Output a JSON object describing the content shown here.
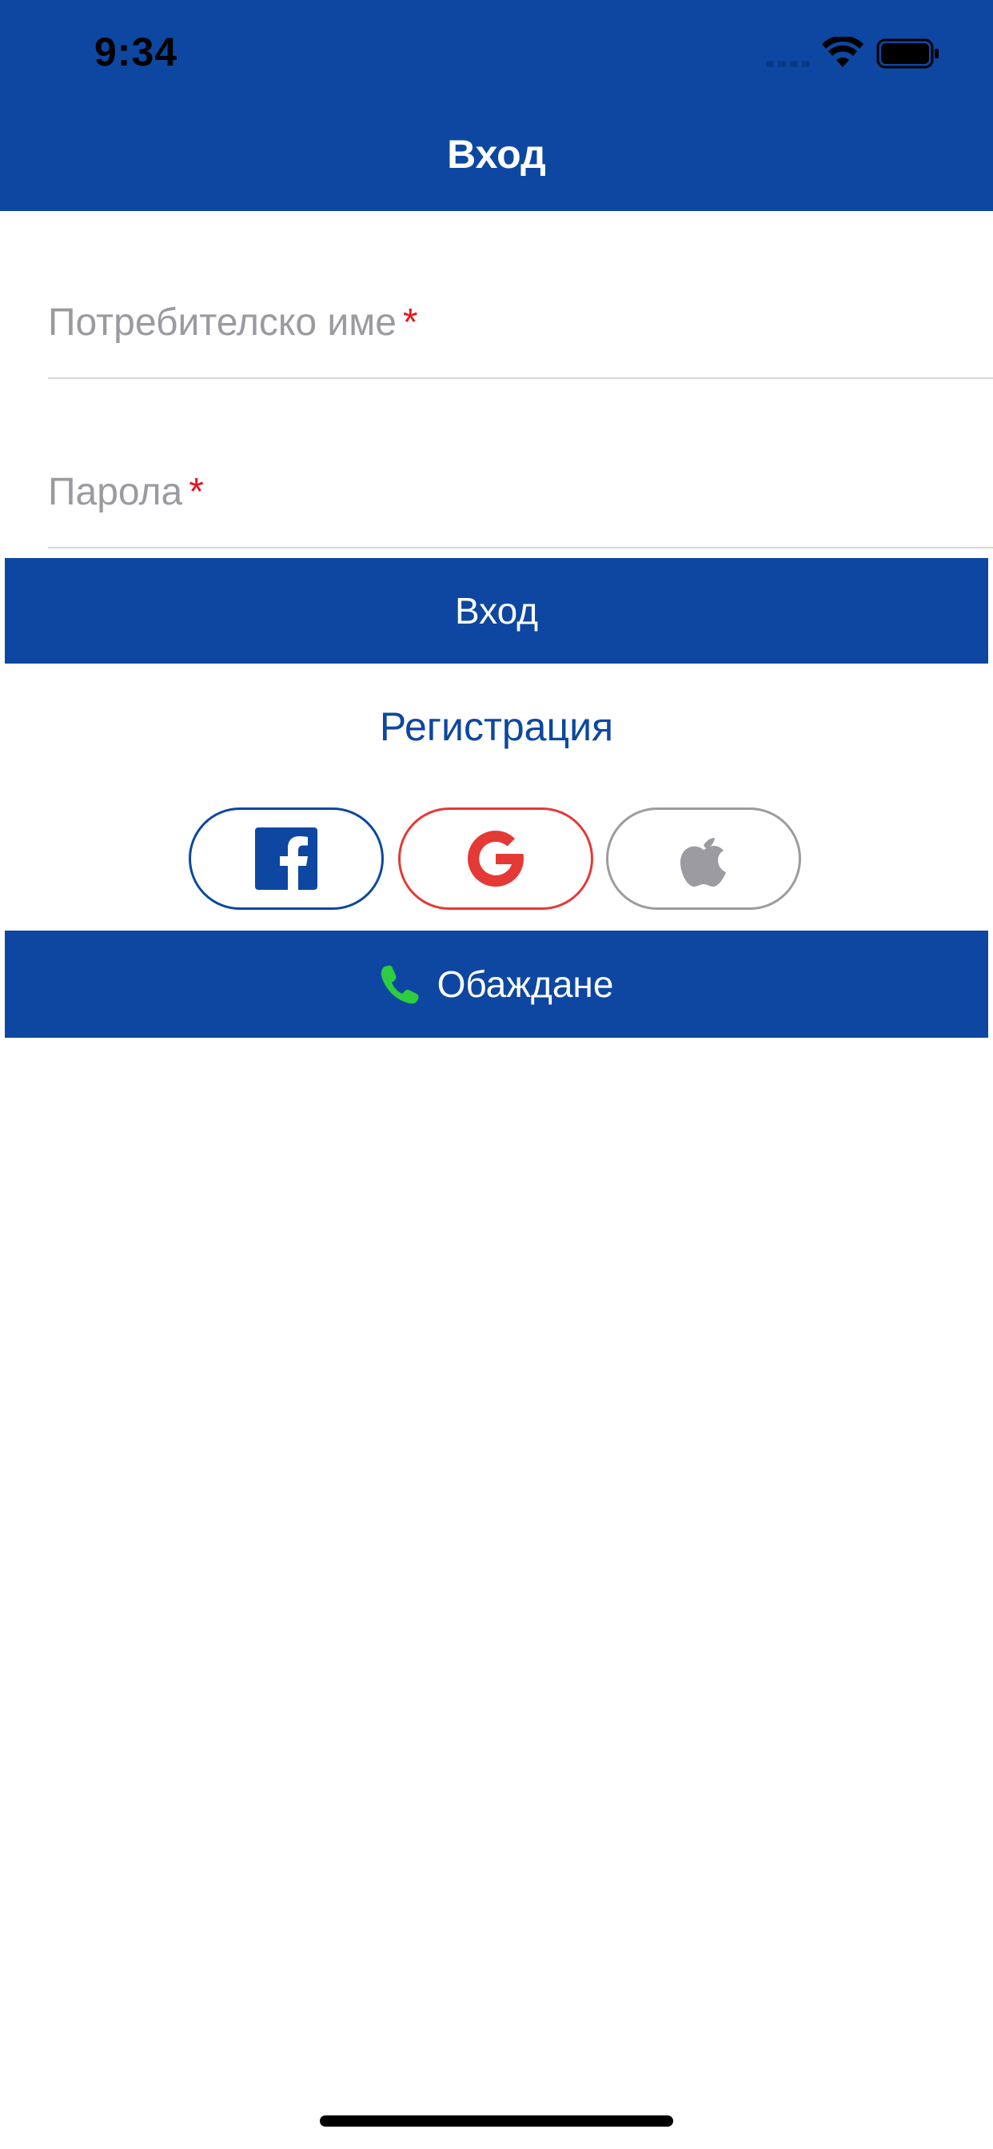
{
  "status_bar": {
    "time": "9:34"
  },
  "header": {
    "title": "Вход"
  },
  "form": {
    "username_label": "Потребителско име",
    "password_label": "Парола",
    "required_marker": "*",
    "login_label": "Вход",
    "register_label": "Регистрация"
  },
  "social": {
    "icons": [
      "facebook-icon",
      "google-icon",
      "apple-icon"
    ]
  },
  "call": {
    "label": "Обаждане",
    "icon": "phone-icon"
  },
  "colors": {
    "brand": "#0D47A1",
    "required": "#E8141B",
    "google": "#E53935",
    "apple": "#9B9BA0",
    "phone": "#2ECC40"
  }
}
